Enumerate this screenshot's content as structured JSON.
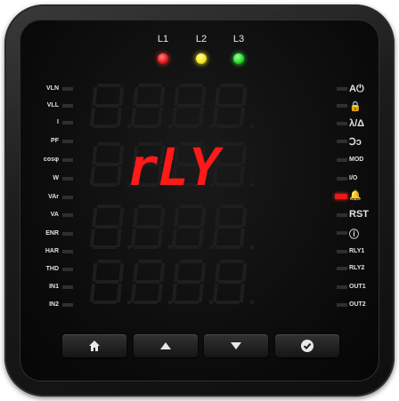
{
  "phases": [
    {
      "label": "L1",
      "color": "#e01a1a"
    },
    {
      "label": "L2",
      "color": "#f2e21a"
    },
    {
      "label": "L3",
      "color": "#22d82a"
    }
  ],
  "left_labels": [
    "VLN",
    "VLL",
    "I",
    "PF",
    "cosφ",
    "W",
    "VAr",
    "VA",
    "ENR",
    "HAR",
    "THD",
    "IN1",
    "IN2"
  ],
  "right_labels": [
    "A⏻",
    "🔒",
    "λ/Δ",
    "Ↄↄ",
    "MOD",
    "I/O",
    "🔔",
    "RST",
    "ⓘ",
    "RLY1",
    "RLY2",
    "OUT1",
    "OUT2"
  ],
  "display": {
    "line2": "rLY",
    "digit_color": "#ff1a1a"
  },
  "buttons": [
    {
      "name": "home-button",
      "icon": "home-icon"
    },
    {
      "name": "up-button",
      "icon": "up-arrow-icon"
    },
    {
      "name": "down-button",
      "icon": "down-arrow-icon"
    },
    {
      "name": "enter-button",
      "icon": "check-icon"
    }
  ]
}
